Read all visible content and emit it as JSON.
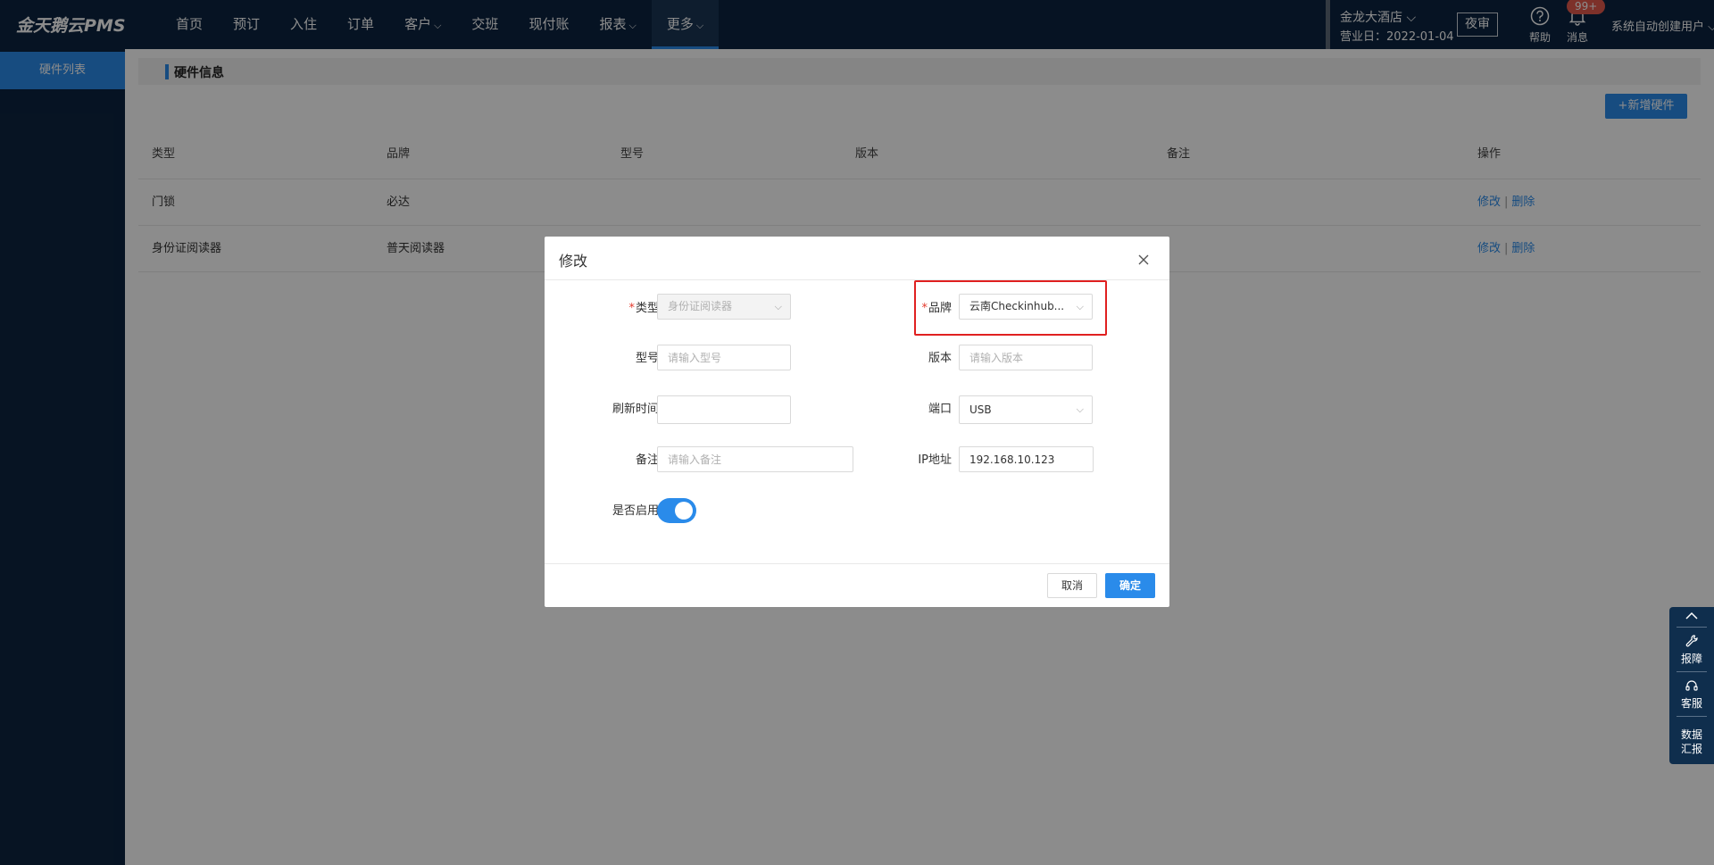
{
  "app": {
    "logo": "金天鹅云PMS",
    "nav": [
      {
        "label": "首页",
        "has_dropdown": false
      },
      {
        "label": "预订",
        "has_dropdown": false
      },
      {
        "label": "入住",
        "has_dropdown": false
      },
      {
        "label": "订单",
        "has_dropdown": false
      },
      {
        "label": "客户",
        "has_dropdown": true
      },
      {
        "label": "交班",
        "has_dropdown": false
      },
      {
        "label": "现付账",
        "has_dropdown": false
      },
      {
        "label": "报表",
        "has_dropdown": true
      },
      {
        "label": "更多",
        "has_dropdown": true,
        "active": true
      }
    ],
    "chevron": "⌵",
    "hotel_name": "金龙大酒店 ⌵",
    "business_date": "营业日：2022-01-04",
    "night_audit": "夜审",
    "help_label": "帮助",
    "message_label": "消息",
    "message_badge": "99+",
    "user_menu": "系统自动创建用户 ⌵"
  },
  "sidebar": {
    "items": [
      {
        "label": "硬件列表",
        "active": true
      }
    ]
  },
  "main": {
    "section_title": "硬件信息",
    "add_button": "+新增硬件",
    "table": {
      "headers": [
        "类型",
        "品牌",
        "型号",
        "版本",
        "备注",
        "操作"
      ],
      "rows": [
        {
          "type": "门锁",
          "brand": "必达",
          "model": "",
          "version": "",
          "remark": ""
        },
        {
          "type": "身份证阅读器",
          "brand": "普天阅读器",
          "model": "",
          "version": "",
          "remark": ""
        }
      ],
      "edit_label": "修改",
      "separator": "|",
      "delete_label": "删除"
    }
  },
  "modal": {
    "title": "修改",
    "fields": {
      "type": {
        "label": "类型",
        "required_mark": "*",
        "value": "身份证阅读器"
      },
      "brand": {
        "label": "品牌",
        "required_mark": "*",
        "value": "云南Checkinhub..."
      },
      "model": {
        "label": "型号",
        "placeholder": "请输入型号"
      },
      "version": {
        "label": "版本",
        "placeholder": "请输入版本"
      },
      "refresh_time": {
        "label": "刷新时间",
        "value": ""
      },
      "port": {
        "label": "端口",
        "value": "USB"
      },
      "remark": {
        "label": "备注",
        "placeholder": "请输入备注"
      },
      "ip": {
        "label": "IP地址",
        "value": "192.168.10.123"
      },
      "enabled": {
        "label": "是否启用",
        "on": true
      }
    },
    "cancel": "取消",
    "confirm": "确定",
    "select_arrow": "⌵"
  },
  "float_toolbar": {
    "report": "报障",
    "service": "客服",
    "data_report_1": "数据",
    "data_report_2": "汇报"
  },
  "colors": {
    "nav_bg": "#0c2440",
    "accent": "#2a8bea",
    "highlight": "#e02020",
    "badge": "#e45a4e"
  }
}
